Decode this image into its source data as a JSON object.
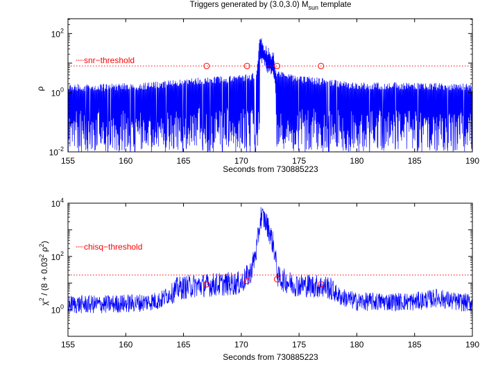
{
  "title": {
    "pre": "Triggers generated by (3.0,3.0) M",
    "sub": "sun",
    "post": " template"
  },
  "chart_data": [
    {
      "type": "line",
      "name": "snr",
      "ylabel": "ρ",
      "xlabel": "Seconds from 730885223",
      "xlim": [
        155,
        190
      ],
      "ylim_log10": [
        -2,
        2.5
      ],
      "yscale": "log",
      "xticks": [
        155,
        160,
        165,
        170,
        175,
        180,
        185,
        190
      ],
      "yticks": [
        {
          "base": "10",
          "exp": "-2",
          "value": -2
        },
        {
          "base": "10",
          "exp": "0",
          "value": 0
        },
        {
          "base": "10",
          "exp": "2",
          "value": 2
        }
      ],
      "series_color": "#0000ff",
      "threshold": {
        "label": "snr−threshold",
        "value": 8,
        "color": "#ff0000",
        "style": "dotted"
      },
      "markers": [
        {
          "x": 167.0,
          "y": 8.0
        },
        {
          "x": 170.5,
          "y": 8.0
        },
        {
          "x": 173.1,
          "y": 8.0
        },
        {
          "x": 176.9,
          "y": 8.0
        }
      ],
      "marker_color": "#ff0000",
      "envelope": [
        [
          155,
          0.3,
          0.0
        ],
        [
          158,
          0.3,
          0.0
        ],
        [
          162,
          0.35,
          0.0
        ],
        [
          164.5,
          0.45,
          0.05
        ],
        [
          167,
          0.55,
          0.1
        ],
        [
          170,
          0.6,
          0.1
        ],
        [
          171.3,
          0.7,
          0.2
        ],
        [
          171.6,
          1.95,
          0.0
        ],
        [
          171.9,
          1.75,
          0.0
        ],
        [
          172.3,
          1.55,
          0.0
        ],
        [
          172.8,
          1.35,
          0.0
        ],
        [
          173.0,
          0.8,
          0.15
        ],
        [
          174.5,
          0.6,
          0.1
        ],
        [
          177,
          0.5,
          0.05
        ],
        [
          180,
          0.35,
          0.0
        ],
        [
          185,
          0.35,
          0.0
        ],
        [
          190,
          0.3,
          0.0
        ]
      ]
    },
    {
      "type": "line",
      "name": "chisq",
      "ylabel_parts": {
        "chi": "χ",
        "sup1": "2",
        "mid": " / (8 + 0.03",
        "sup2": "2",
        "rho": " ρ",
        "sup3": "2",
        "end": ")"
      },
      "xlabel": "Seconds from 730885223",
      "xlim": [
        155,
        190
      ],
      "ylim_log10": [
        -1,
        4
      ],
      "yscale": "log",
      "xticks": [
        155,
        160,
        165,
        170,
        175,
        180,
        185,
        190
      ],
      "yticks": [
        {
          "base": "10",
          "exp": "0",
          "value": 0
        },
        {
          "base": "10",
          "exp": "2",
          "value": 2
        },
        {
          "base": "10",
          "exp": "4",
          "value": 4
        }
      ],
      "series_color": "#0000ff",
      "threshold": {
        "label": "chisq−threshold",
        "value": 20,
        "color": "#ff0000",
        "style": "dotted"
      },
      "markers": [
        {
          "x": 167.0,
          "y": 9.0
        },
        {
          "x": 170.5,
          "y": 12.0
        },
        {
          "x": 173.1,
          "y": 14.0
        },
        {
          "x": 176.9,
          "y": 9.0
        }
      ],
      "marker_color": "#ff0000",
      "envelope": [
        [
          155,
          0.2
        ],
        [
          158,
          0.2
        ],
        [
          161,
          0.25
        ],
        [
          163,
          0.35
        ],
        [
          164.5,
          0.8
        ],
        [
          166,
          0.9
        ],
        [
          168,
          0.95
        ],
        [
          170,
          1.0
        ],
        [
          170.8,
          1.4
        ],
        [
          171.3,
          2.2
        ],
        [
          171.7,
          3.5
        ],
        [
          172.0,
          3.4
        ],
        [
          172.4,
          3.0
        ],
        [
          172.8,
          2.4
        ],
        [
          173.2,
          1.2
        ],
        [
          174.5,
          0.95
        ],
        [
          176,
          0.9
        ],
        [
          177.5,
          0.85
        ],
        [
          178.5,
          0.5
        ],
        [
          180,
          0.3
        ],
        [
          185,
          0.3
        ],
        [
          187,
          0.45
        ],
        [
          188.5,
          0.3
        ],
        [
          190,
          0.25
        ]
      ]
    }
  ]
}
